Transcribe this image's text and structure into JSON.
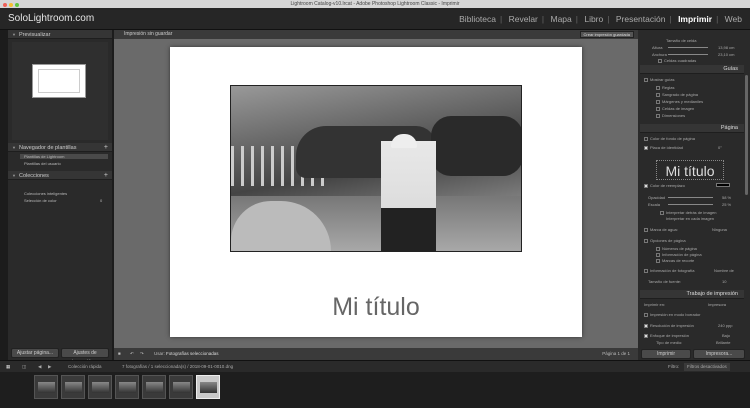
{
  "os": {
    "window_title": "Lightroom Catalog-v10.lrcat - Adobe Photoshop Lightroom Classic - Imprimir"
  },
  "brand": "SoloLightroom.com",
  "modules": [
    "Biblioteca",
    "Revelar",
    "Mapa",
    "Libro",
    "Presentación",
    "Imprimir",
    "Web"
  ],
  "active_module": "Imprimir",
  "left": {
    "preview_header": "Previsualizar",
    "template_header": "Navegador de plantillas",
    "template_items": [
      "Plantillas de Lightroom",
      "Plantillas del usuario"
    ],
    "collections_header": "Colecciones",
    "collection_items": [
      "Colecciones inteligentes",
      "Selección de color"
    ],
    "collection_count": "0",
    "plus_icon": "plus-icon",
    "btn_adjust": "Ajustar página...",
    "btn_print_settings": "Ajustes de impresión..."
  },
  "center": {
    "tab_label": "Impresión sin guardar",
    "save_button": "Crear impresión guardada",
    "page_title": "Mi título",
    "bottom_use_label": "Usar:",
    "bottom_selection": "Fotografías seleccionadas",
    "page_indicator": "Página 1 de 1"
  },
  "right": {
    "cell_size_label": "Tamaño de celda",
    "height_label": "Altura",
    "height_value": "13,98 cm",
    "width_label": "Anchura",
    "width_value": "23,10 cm",
    "keep_square": "Celdas cuadradas",
    "guides_header": "Guías",
    "show_guides": "Mostrar guías",
    "guide_items": [
      "Reglas",
      "Sangrado de página",
      "Márgenes y medianiles",
      "Celdas de imagen",
      "Dimensiones"
    ],
    "page_header": "Página",
    "bg_color_label": "Color de fondo de página",
    "identity_plate": "Placa de identidad",
    "identity_angle": "0°",
    "identity_text": "Mi título",
    "override_color": "Color de reemplazo",
    "opacity_label": "Opacidad",
    "opacity_value": "58 %",
    "scale_label": "Escala",
    "scale_value": "25 %",
    "behind_image": "Interpretar detrás de imagen",
    "on_every_image": "Interpretar en cada imagen",
    "watermark_label": "Marca de agua:",
    "watermark_value": "Ninguna",
    "page_options_label": "Opciones de página",
    "page_option_items": [
      "Números de página",
      "Información de página",
      "Marcas de recorte"
    ],
    "photo_info_label": "Información de fotografía",
    "photo_info_value": "Nombre de",
    "font_size_label": "Tamaño de fuente:",
    "font_size_value": "10",
    "print_job_header": "Trabajo de impresión",
    "print_to_label": "Imprimir en:",
    "print_to_value": "Impresora",
    "draft_mode": "Impresión en modo borrador",
    "resolution_label": "Resolución de impresión",
    "resolution_value": "240 ppp",
    "sharpen_label": "Enfoque de impresión",
    "sharpen_value": "Bajo",
    "media_label": "Tipo de medio:",
    "media_value": "Brillante",
    "btn_print": "Imprimir",
    "btn_printer": "Impresora..."
  },
  "filmstrip": {
    "breadcrumb": "Colección rápida",
    "info": "7 fotografías / 1 seleccionada(s) / 2018-09-01-0010.dng",
    "filter_label": "Filtro:",
    "filter_value": "Filtros desactivados",
    "thumb_count": 7,
    "selected_index": 6
  }
}
